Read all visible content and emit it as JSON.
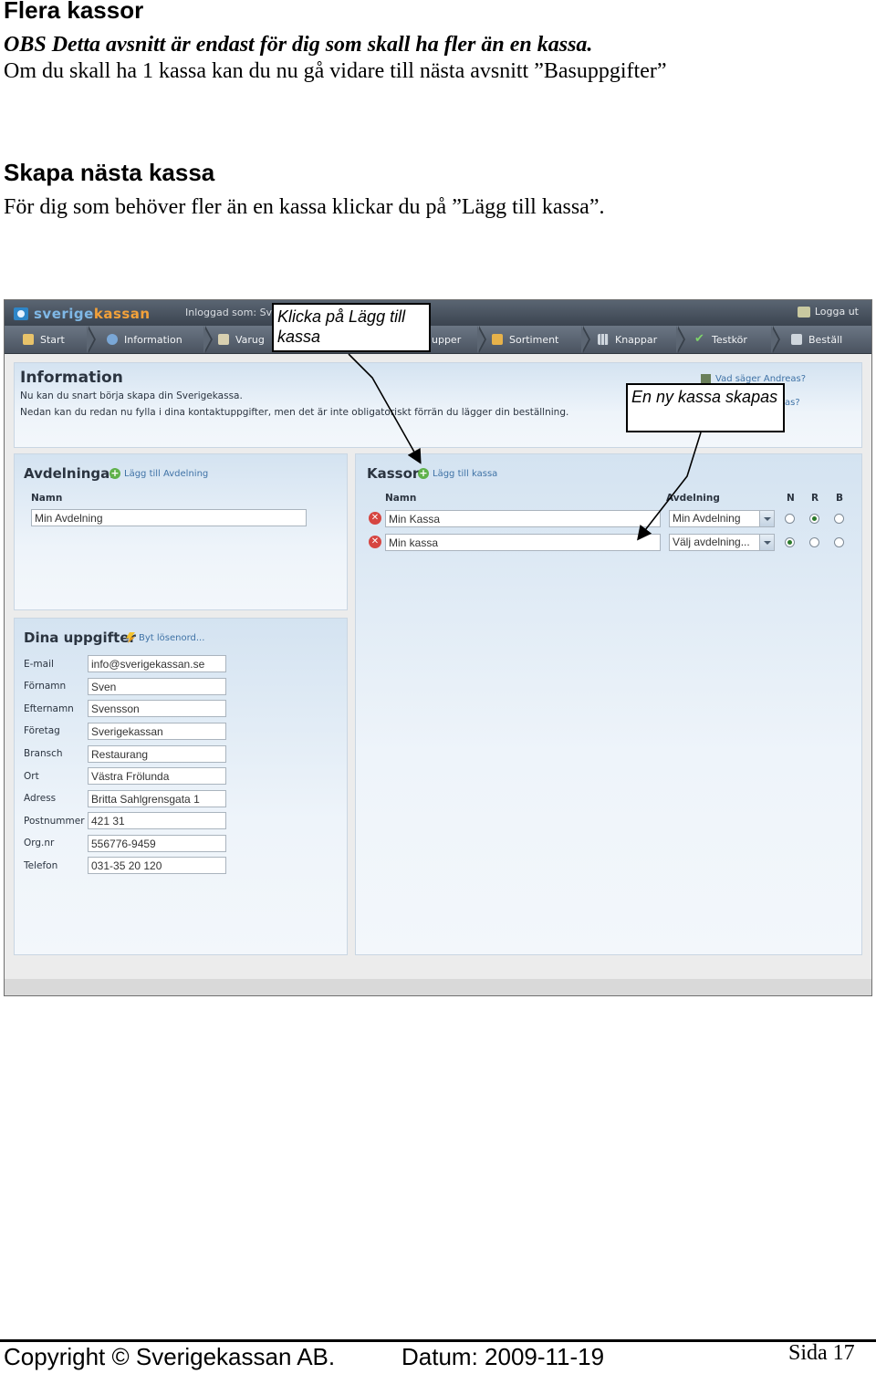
{
  "doc": {
    "section_title": "Flera kassor",
    "obs_line": "OBS Detta avsnitt är endast för dig som skall ha fler än en kassa.",
    "skip_line": "Om du skall ha 1 kassa kan du nu gå vidare till nästa avsnitt ”Basuppgifter”",
    "subheading": "Skapa nästa kassa",
    "instruction": "För dig som behöver fler än en kassa klickar du på ”Lägg till kassa”."
  },
  "app": {
    "brand_part1": "sverige",
    "brand_part2": "kassan",
    "logged_in": "Inloggad som: Sve",
    "logout": "Logga ut",
    "nav": [
      "Start",
      "Information",
      "Varug",
      "upper",
      "Sortiment",
      "Knappar",
      "Testkör",
      "Beställ"
    ],
    "info": {
      "title": "Information",
      "line1": "Nu kan du snart börja skapa din Sverigekassa.",
      "line2": "Nedan kan du redan nu fylla i dina kontaktuppgifter, men det är inte obligatoriskt förrän du lägger din beställning.",
      "side1": "Vad säger Andreas?",
      "side2": "as?"
    },
    "avdelningar": {
      "title": "Avdelningar",
      "add_label": "Lägg till Avdelning",
      "col_name": "Namn",
      "value": "Min Avdelning"
    },
    "kassor": {
      "title": "Kassor",
      "add_label": "Lägg till kassa",
      "col_name": "Namn",
      "col_dept": "Avdelning",
      "col_n": "N",
      "col_r": "R",
      "col_b": "B",
      "rows": [
        {
          "name": "Min Kassa",
          "dept": "Min Avdelning",
          "selected": "R"
        },
        {
          "name": "Min kassa",
          "dept": "Välj avdelning...",
          "selected": "N"
        }
      ]
    },
    "uppgifter": {
      "title": "Dina uppgifter",
      "change_pw": "Byt lösenord...",
      "fields": [
        {
          "label": "E-mail",
          "value": "info@sverigekassan.se"
        },
        {
          "label": "Förnamn",
          "value": "Sven"
        },
        {
          "label": "Efternamn",
          "value": "Svensson"
        },
        {
          "label": "Företag",
          "value": "Sverigekassan"
        },
        {
          "label": "Bransch",
          "value": "Restaurang"
        },
        {
          "label": "Ort",
          "value": "Västra Frölunda"
        },
        {
          "label": "Adress",
          "value": "Britta Sahlgrensgata 1"
        },
        {
          "label": "Postnummer",
          "value": "421 31"
        },
        {
          "label": "Org.nr",
          "value": "556776-9459"
        },
        {
          "label": "Telefon",
          "value": "031-35 20 120"
        }
      ]
    }
  },
  "callouts": {
    "add_till": "Klicka på Lägg till kassa",
    "new_register": "En ny kassa skapas"
  },
  "footer": {
    "copyright": "Copyright ©  Sverigekassan AB.",
    "date": "Datum:  2009-11-19",
    "page": "Sida   17"
  },
  "colors": {
    "brand_blue": "#7fb8e6",
    "brand_orange": "#f2a13a",
    "link_blue": "#3f72a6",
    "delete_red": "#d64541",
    "add_green": "#5fb14a"
  }
}
